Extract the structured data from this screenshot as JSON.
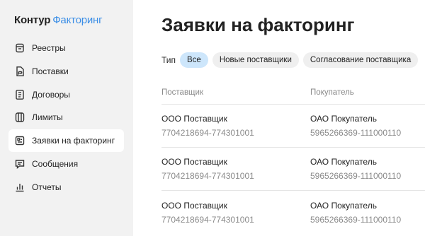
{
  "app": {
    "brand": "Контур",
    "product": "Факторинг"
  },
  "sidebar": {
    "items": [
      {
        "label": "Реестры",
        "icon": "registry-icon",
        "active": false
      },
      {
        "label": "Поставки",
        "icon": "document-icon",
        "active": false
      },
      {
        "label": "Договоры",
        "icon": "contract-icon",
        "active": false
      },
      {
        "label": "Лимиты",
        "icon": "limits-icon",
        "active": false
      },
      {
        "label": "Заявки на факторинг",
        "icon": "application-icon",
        "active": true
      },
      {
        "label": "Сообщения",
        "icon": "message-icon",
        "active": false
      },
      {
        "label": "Отчеты",
        "icon": "reports-icon",
        "active": false
      }
    ]
  },
  "main": {
    "title": "Заявки на факторинг",
    "filter": {
      "label": "Тип",
      "chips": [
        {
          "label": "Все",
          "active": true
        },
        {
          "label": "Новые поставщики",
          "active": false
        },
        {
          "label": "Согласование поставщика",
          "active": false
        }
      ]
    },
    "table": {
      "columns": [
        "Поставщик",
        "Покупатель"
      ],
      "rows": [
        {
          "supplier": "ООО Поставщик",
          "supplier_id": "7704218694-774301001",
          "buyer": "ОАО Покупатель",
          "buyer_id": "5965266369-111000110"
        },
        {
          "supplier": "ООО Поставщик",
          "supplier_id": "7704218694-774301001",
          "buyer": "ОАО Покупатель",
          "buyer_id": "5965266369-111000110"
        },
        {
          "supplier": "ООО Поставщик",
          "supplier_id": "7704218694-774301001",
          "buyer": "ОАО Покупатель",
          "buyer_id": "5965266369-111000110"
        }
      ]
    }
  },
  "colors": {
    "accent": "#3b8ee6",
    "chip_active": "#cde6fb",
    "sidebar_bg": "#f2f2f2"
  }
}
